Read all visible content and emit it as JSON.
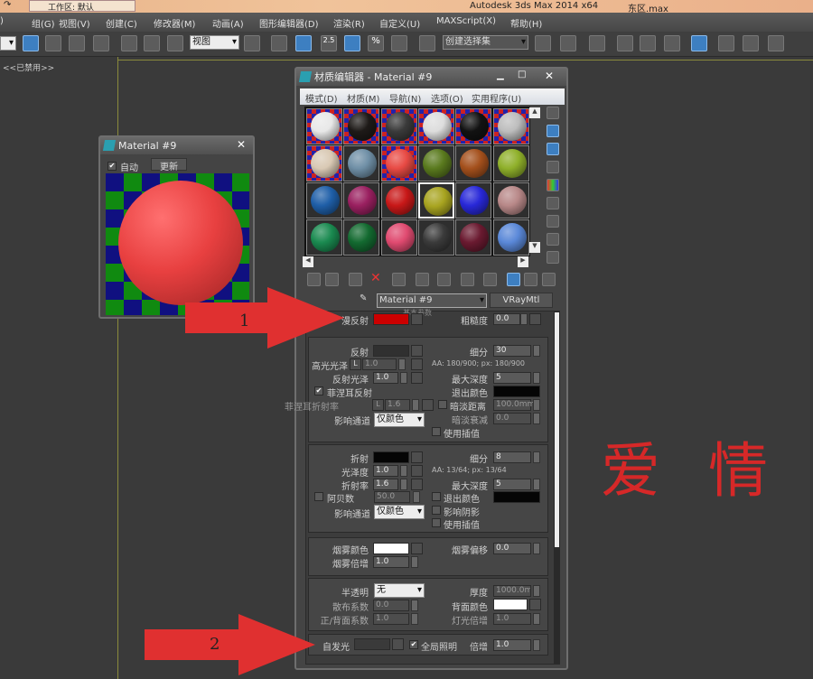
{
  "titlebar": {
    "workspace_label": "工作区: 默认",
    "app_title": "Autodesk 3ds Max  2014 x64",
    "file_name": "东区.max"
  },
  "menubar": {
    "items": [
      ")",
      "组(G)",
      "视图(V)",
      "创建(C)",
      "修改器(M)",
      "动画(A)",
      "图形编辑器(D)",
      "渲染(R)",
      "自定义(U)",
      "MAXScript(X)",
      "帮助(H)"
    ]
  },
  "toolbar": {
    "view_dropdown": "视图",
    "snap_label": "2.5",
    "percent_label": "%",
    "selection_set_dropdown": "创建选择集"
  },
  "viewport": {
    "label": "<<已禁用>>"
  },
  "preview_window": {
    "title": "Material #9",
    "auto_label": "自动",
    "auto_checked": true,
    "update_button": "更新"
  },
  "material_editor": {
    "title": "材质编辑器 - Material #9",
    "menu": [
      "模式(D)",
      "材质(M)",
      "导航(N)",
      "选项(O)",
      "实用程序(U)"
    ],
    "sample_colors": [
      [
        "#e8e8e8",
        "#1e1a18",
        "#3a3a3a",
        "#dddddd",
        "#121212",
        "#bdbdbd"
      ],
      [
        "#d9c9b4",
        "#6f8fa6",
        "#e84a44",
        "#5a7a1e",
        "#a4501c",
        "#8fb02a"
      ],
      [
        "#1f5fa8",
        "#9a2060",
        "#c81818",
        "#a8a420",
        "#2828d8",
        "#b88888"
      ],
      [
        "#1a8a50",
        "#136a30",
        "#e04a70",
        "#3a3a3a",
        "#6a1a30",
        "#5a88d8"
      ]
    ],
    "sample_checker_rows": [
      [
        true,
        true,
        true,
        true,
        true,
        true
      ],
      [
        true,
        false,
        true,
        false,
        false,
        false
      ],
      [
        false,
        false,
        false,
        false,
        false,
        false
      ],
      [
        false,
        false,
        false,
        false,
        false,
        false
      ]
    ],
    "selected_sample": "2-3",
    "material_name": "Material #9",
    "material_type": "VRayMtl",
    "rollout_title": "基本参数",
    "params": {
      "diffuse_label": "漫反射",
      "diffuse_color": "#cc0000",
      "roughness_label": "粗糙度",
      "roughness": "0.0",
      "reflect_label": "反射",
      "subdivs_label": "细分",
      "reflect_subdivs": "30",
      "hilight_gloss_label": "高光光泽",
      "hilight_gloss": "1.0",
      "lock_label": "L",
      "reflect_aa": "AA: 180/900; px: 180/900",
      "refl_gloss_label": "反射光泽",
      "refl_gloss": "1.0",
      "max_depth_label": "最大深度",
      "reflect_max_depth": "5",
      "fresnel_label": "菲涅耳反射",
      "fresnel_checked": true,
      "exit_color_label": "退出颜色",
      "fresnel_ior_label": "菲涅耳折射率",
      "fresnel_ior": "1.6",
      "dim_distance_label": "暗淡距离",
      "dim_distance": "100.0mm",
      "affect_channels_label": "影响通道",
      "affect_channels": "仅颜色",
      "dim_falloff_label": "暗淡衰减",
      "dim_falloff": "0.0",
      "use_interp_label": "使用插值",
      "refract_label": "折射",
      "refract_subdivs": "8",
      "gloss_label": "光泽度",
      "refr_gloss": "1.0",
      "refract_aa": "AA: 13/64; px: 13/64",
      "ior_label": "折射率",
      "ior": "1.6",
      "refract_max_depth": "5",
      "abbe_label": "阿贝数",
      "abbe": "50.0",
      "affect_shadows_label": "影响阴影",
      "fog_color_label": "烟雾颜色",
      "fog_bias_label": "烟雾偏移",
      "fog_bias": "0.0",
      "fog_mult_label": "烟雾倍增",
      "fog_mult": "1.0",
      "translucency_label": "半透明",
      "translucency": "无",
      "thickness_label": "厚度",
      "thickness": "1000.0mm",
      "scatter_label": "散布系数",
      "scatter": "0.0",
      "back_color_label": "背面颜色",
      "fwd_back_label": "正/背面系数",
      "fwd_back": "1.0",
      "light_mult_label": "灯光倍增",
      "light_mult": "1.0",
      "self_illum_label": "自发光",
      "gi_label": "全局照明",
      "gi_checked": true,
      "mult_label": "倍增",
      "self_illum_mult": "1.0"
    }
  },
  "annotations": {
    "arrow1_label": "1",
    "arrow2_label": "2",
    "overlay_text": "爱 情"
  }
}
